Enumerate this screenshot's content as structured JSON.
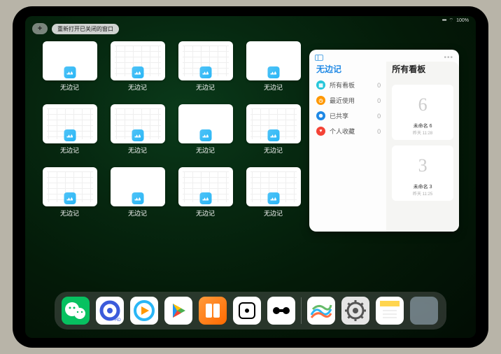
{
  "status": {
    "signal": "••••",
    "wifi": "⌔",
    "battery": "100%"
  },
  "reopen_label": "重新打开已关闭的窗口",
  "plus": "+",
  "app_name": "无边记",
  "windows": [
    {
      "label": "无边记",
      "style": "blank"
    },
    {
      "label": "无边记",
      "style": "cal"
    },
    {
      "label": "无边记",
      "style": "cal"
    },
    {
      "label": "无边记",
      "style": "blank"
    },
    {
      "label": "无边记",
      "style": "cal"
    },
    {
      "label": "无边记",
      "style": "cal"
    },
    {
      "label": "无边记",
      "style": "blank"
    },
    {
      "label": "无边记",
      "style": "cal"
    },
    {
      "label": "无边记",
      "style": "cal"
    },
    {
      "label": "无边记",
      "style": "blank"
    },
    {
      "label": "无边记",
      "style": "cal"
    },
    {
      "label": "无边记",
      "style": "cal"
    }
  ],
  "panel": {
    "left_title": "无边记",
    "right_title": "所有看板",
    "categories": [
      {
        "icon": "grid",
        "label": "所有看板",
        "count": 0,
        "color": "c-cyan"
      },
      {
        "icon": "clock",
        "label": "最近使用",
        "count": 0,
        "color": "c-orange"
      },
      {
        "icon": "people",
        "label": "已共享",
        "count": 0,
        "color": "c-blue"
      },
      {
        "icon": "heart",
        "label": "个人收藏",
        "count": 0,
        "color": "c-red"
      }
    ],
    "boards": [
      {
        "glyph": "6",
        "name": "未命名 6",
        "time": "昨天 11:28"
      },
      {
        "glyph": "3",
        "name": "未命名 3",
        "time": "昨天 11:25"
      }
    ]
  },
  "dock": {
    "left": [
      {
        "name": "wechat",
        "bg": "#07c160",
        "glyph": "wechat"
      },
      {
        "name": "quark",
        "bg": "#ffffff",
        "glyph": "quark"
      },
      {
        "name": "tencent-video",
        "bg": "#ffffff",
        "glyph": "qvideo"
      },
      {
        "name": "play",
        "bg": "#ffffff",
        "glyph": "play"
      },
      {
        "name": "books",
        "bg": "linear-gradient(135deg,#ff9a3c,#ff6a00)",
        "glyph": "books"
      },
      {
        "name": "dice",
        "bg": "#ffffff",
        "glyph": "dice"
      },
      {
        "name": "dumbbell",
        "bg": "#ffffff",
        "glyph": "dumbbell"
      }
    ],
    "right": [
      {
        "name": "freeform",
        "bg": "#ffffff",
        "glyph": "freeform"
      },
      {
        "name": "settings",
        "bg": "#e5e5e5",
        "glyph": "gear"
      },
      {
        "name": "notes",
        "bg": "#ffffff",
        "glyph": "notes"
      },
      {
        "name": "app-library",
        "bg": "folder",
        "glyph": "folder"
      }
    ]
  }
}
